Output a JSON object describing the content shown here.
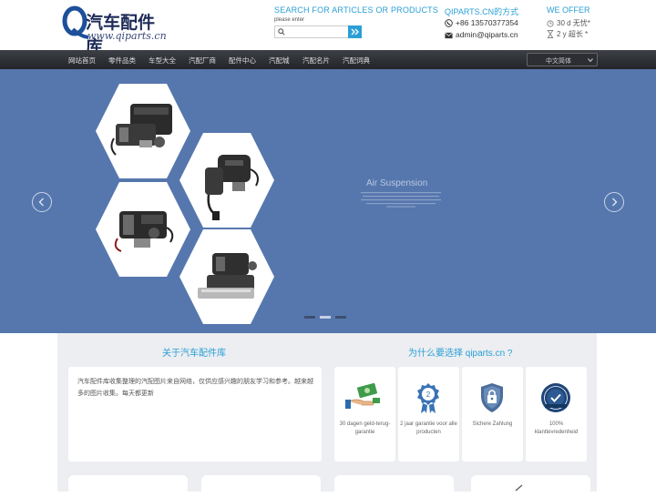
{
  "header": {
    "logo_cn": "汽车配件库",
    "logo_url": "www.qiparts.cn",
    "search_title": "SEARCH FOR ARTICLES OR PRODUCTS",
    "search_hint": "please enter",
    "search_placeholder": "",
    "contact_title": "QIPARTS.CN的方式",
    "phone": "+86 13570377354",
    "email": "admin@qiparts.cn",
    "offer_title": "WE OFFER",
    "offer_1": "30 d 无忧*",
    "offer_2": "2 y 超长 *"
  },
  "nav": {
    "items": [
      "网站首页",
      "零件品类",
      "车型大全",
      "汽配厂商",
      "配件中心",
      "汽配城",
      "汽配名片",
      "汽配词典"
    ],
    "language": "中文简体"
  },
  "banner": {
    "title": "Air Suspension",
    "slide_count": 3,
    "active_slide": 2
  },
  "about": {
    "title": "关于汽车配件库",
    "text": "汽车配件库收集整理的汽配图片来自网络，仅供应感兴趣的朋友学习和参考。越来越多的图片收集。每天都更新"
  },
  "why": {
    "title": "为什么要选择 qiparts.cn ?",
    "cards": [
      {
        "label": "30 dagen geld-terug-garantie",
        "icon": "money-back-icon"
      },
      {
        "label": "2 jaar garantie voor alle producten",
        "icon": "warranty-badge-icon"
      },
      {
        "label": "Sichere Zahlung",
        "icon": "secure-shield-icon"
      },
      {
        "label": "100% klanttevredenheid",
        "icon": "satisfaction-seal-icon"
      }
    ]
  },
  "colors": {
    "accent": "#2a9fd6",
    "banner": "#5677ad",
    "nav": "#2f3136"
  }
}
